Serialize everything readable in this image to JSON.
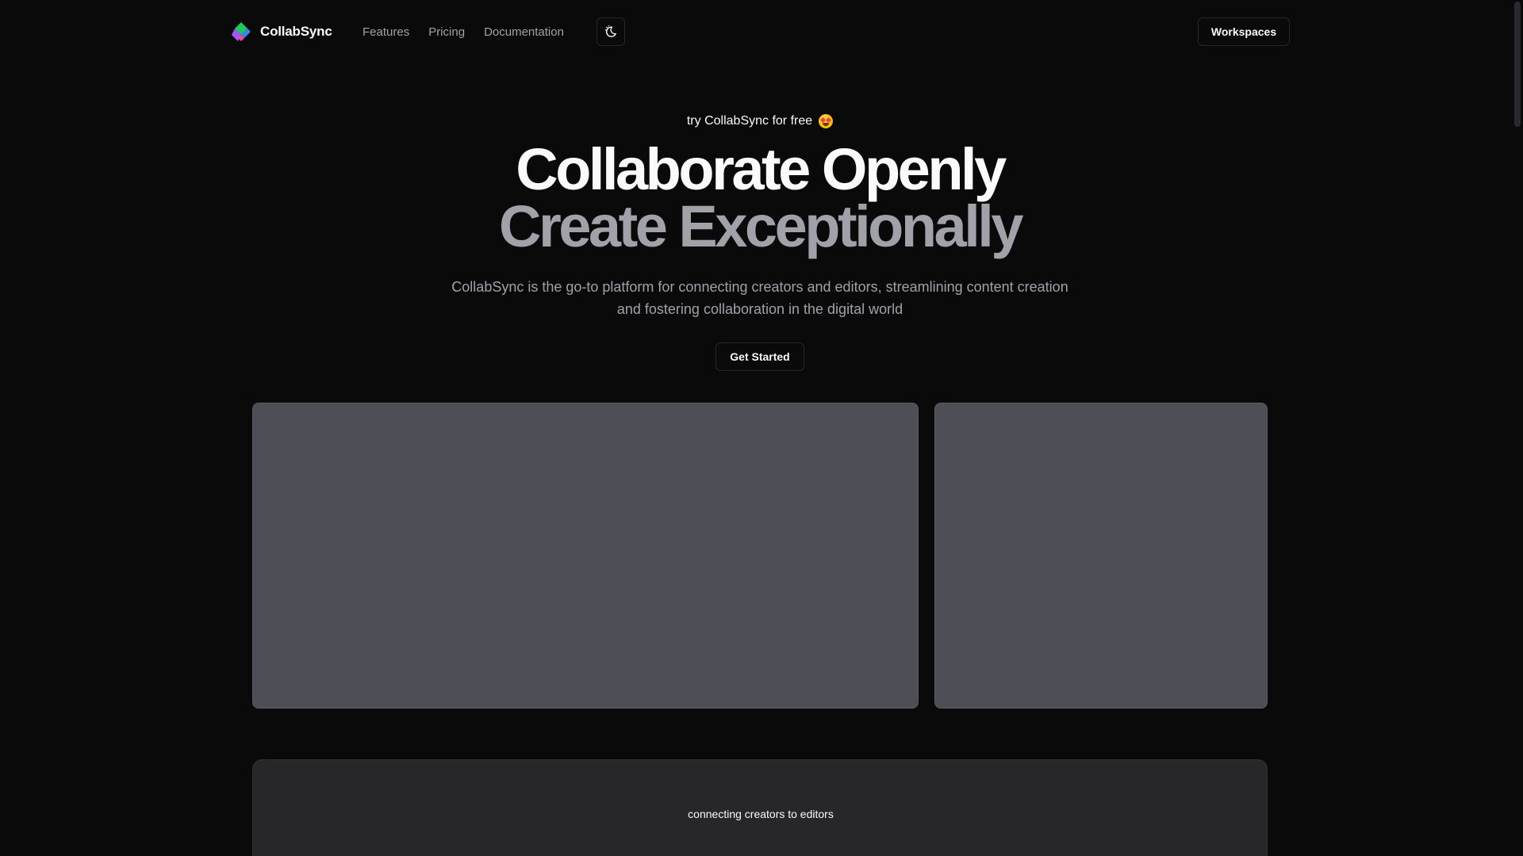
{
  "brand": {
    "name": "CollabSync"
  },
  "nav": {
    "items": [
      {
        "label": "Features"
      },
      {
        "label": "Pricing"
      },
      {
        "label": "Documentation"
      }
    ],
    "theme_toggle_icon": "moon-sparkle-icon",
    "workspaces_label": "Workspaces"
  },
  "hero": {
    "eyebrow": "try CollabSync for free",
    "eyebrow_emoji": "star-struck-emoji",
    "headline_line1": "Collaborate Openly",
    "headline_line2": "Create Exceptionally",
    "subtext": "CollabSync is the go-to platform for connecting creators and editors, streamlining content creation and fostering collaboration in the digital world",
    "cta_label": "Get Started"
  },
  "feature_section": {
    "eyebrow": "connecting creators to editors",
    "heading": ""
  },
  "colors": {
    "background": "#0a0a0b",
    "text_primary": "#fafafa",
    "text_muted": "#a1a1aa",
    "card_placeholder": "#4e4e56",
    "section_bg": "#27272a",
    "border": "#27272a"
  }
}
